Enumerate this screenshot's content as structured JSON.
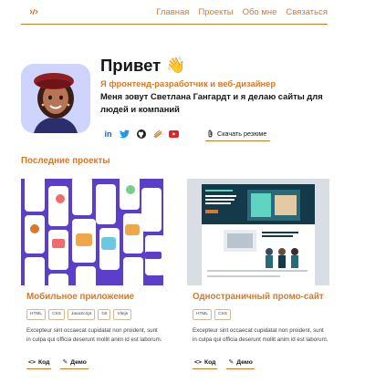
{
  "nav": {
    "items": [
      "Главная",
      "Проекты",
      "Обо мне",
      "Связаться"
    ]
  },
  "hero": {
    "greeting": "Привет",
    "wave_emoji": "👋",
    "role": "Я фронтенд-разработчик и веб-дизайнер",
    "intro": "Меня зовут Светлана Гангардт и я делаю сайты для людей и компаний",
    "resume_label": "Скачать резюме",
    "social_icons": [
      "linkedin-icon",
      "twitter-icon",
      "github-icon",
      "stackblitz-icon",
      "youtube-icon"
    ]
  },
  "projects": {
    "title": "Последние проекты",
    "cards": [
      {
        "title": "Мобильное приложение",
        "tags": [
          "HTML",
          "CSS",
          "JavaScript",
          "Git",
          "Vitejs"
        ],
        "description": "Excepteur sint occaecat cupidatat non proident, sunt in culpa qui officia deserunt mollit anim id est laborum.",
        "code_label": "Код",
        "demo_label": "Демо"
      },
      {
        "title": "Одностраничный промо-сайт",
        "tags": [
          "HTML",
          "CSS"
        ],
        "description": "Excepteur sint occaecat cupidatat non proident, sunt in culpa qui officia deserunt mollit anim id est laborum.",
        "code_label": "Код",
        "demo_label": "Демо"
      }
    ]
  },
  "colors": {
    "accent": "#d8782a",
    "avatar_bg": "#cfd4ff",
    "card1_bg": "#5b3ec9"
  }
}
